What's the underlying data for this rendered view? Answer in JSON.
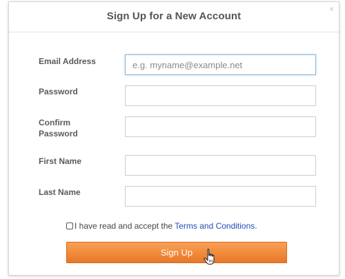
{
  "dialog": {
    "title": "Sign Up for a New Account",
    "close_glyph": "×"
  },
  "form": {
    "fields": [
      {
        "label": "Email Address",
        "placeholder": "e.g. myname@example.net",
        "value": ""
      },
      {
        "label": "Password",
        "placeholder": "",
        "value": ""
      },
      {
        "label": "Confirm Password",
        "placeholder": "",
        "value": ""
      },
      {
        "label": "First Name",
        "placeholder": "",
        "value": ""
      },
      {
        "label": "Last Name",
        "placeholder": "",
        "value": ""
      }
    ],
    "terms": {
      "checked": false,
      "text_before": "I have read and accept the ",
      "link_text": "Terms and Conditions",
      "text_after": "."
    },
    "submit_label": "Sign Up"
  },
  "icons": {
    "close": "close-icon",
    "cursor": "hand-pointer-icon"
  },
  "colors": {
    "button_orange": "#f08a3a",
    "link_blue": "#1f4fb5",
    "title_gray": "#555555"
  }
}
